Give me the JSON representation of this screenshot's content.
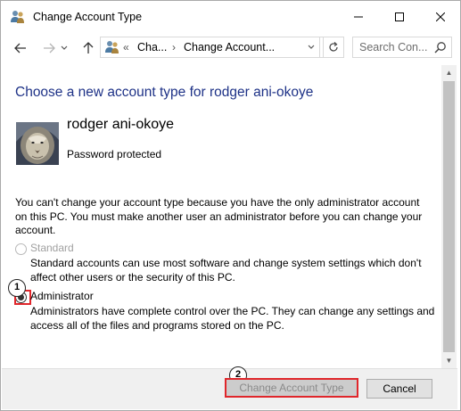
{
  "window": {
    "title": "Change Account Type"
  },
  "address_bar": {
    "chevron": "«",
    "crumb_1": "Cha...",
    "separator": "›",
    "crumb_2": "Change Account...",
    "search_placeholder": "Search Con..."
  },
  "main": {
    "heading": "Choose a new account type for rodger ani-okoye",
    "user_name": "rodger ani-okoye",
    "user_status": "Password protected",
    "notice": "You can't change your account type because you have the only administrator account on this PC. You must make another user an administrator before you can change your account.",
    "options": [
      {
        "label": "Standard",
        "description": "Standard accounts can use most software and change system settings which don't affect other users or the security of this PC.",
        "selected": false,
        "enabled": false
      },
      {
        "label": "Administrator",
        "description": "Administrators have complete control over the PC. They can change any settings and access all of the files and programs stored on the PC.",
        "selected": true,
        "enabled": true
      }
    ]
  },
  "buttons": {
    "change_label": "Change Account Type",
    "change_enabled": false,
    "cancel_label": "Cancel"
  },
  "annotations": {
    "step_1": "1",
    "step_2": "2",
    "highlight_color": "#e0262b"
  },
  "colors": {
    "heading": "#1e3287",
    "disabled_text": "#a0a0a0"
  },
  "icons": {
    "title": "users-icon",
    "address": "users-icon",
    "back": "arrow-left-icon",
    "forward": "arrow-right-icon",
    "recent": "chevron-down-icon",
    "up": "arrow-up-icon",
    "refresh": "refresh-icon",
    "search": "search-icon"
  }
}
